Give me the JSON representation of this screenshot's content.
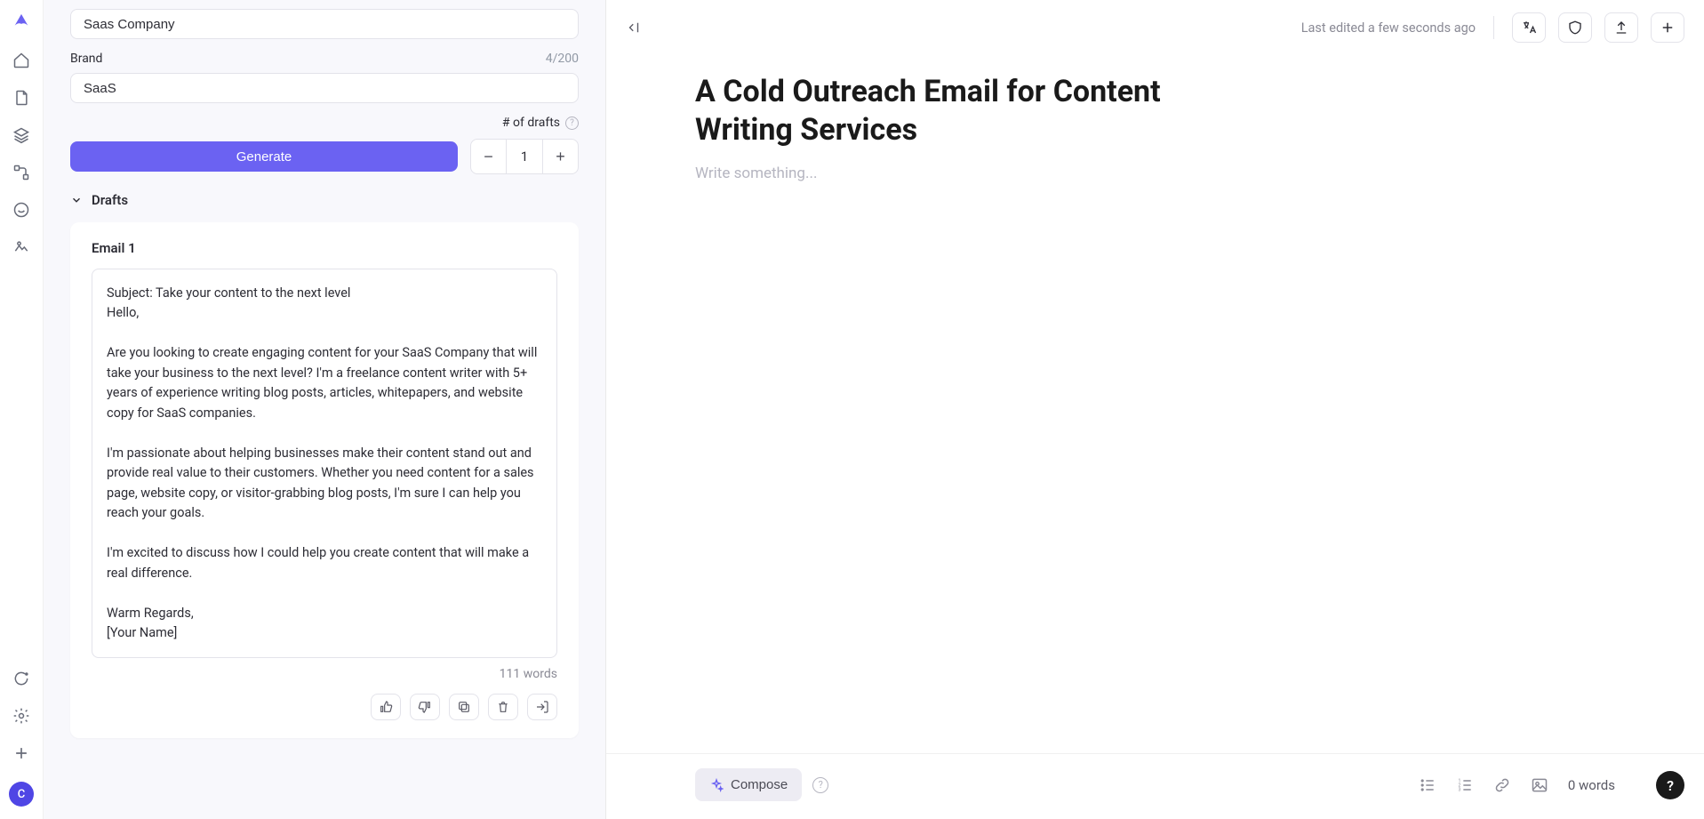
{
  "sidebar": {
    "avatar_initial": "C"
  },
  "left_panel": {
    "company_input": {
      "value": "Saas Company"
    },
    "brand": {
      "label": "Brand",
      "counter": "4/200",
      "value": "SaaS"
    },
    "drafts_count": {
      "label": "# of drafts",
      "value": "1"
    },
    "generate_label": "Generate",
    "drafts_header": "Drafts",
    "draft": {
      "title": "Email 1",
      "body": "Subject: Take your content to the next level\nHello,\n\nAre you looking to create engaging content for your SaaS Company that will take your business to the next level? I'm a freelance content writer with 5+ years of experience writing blog posts, articles, whitepapers, and website copy for SaaS companies.\n\nI'm passionate about helping businesses make their content stand out and provide real value to their customers. Whether you need content for a sales page, website copy, or visitor-grabbing blog posts, I'm sure I can help you reach your goals.\n\nI'm excited to discuss how I could help you create content that will make a real difference.\n\nWarm Regards,\n[Your Name]",
      "word_count": "111 words"
    }
  },
  "editor": {
    "last_edited": "Last edited a few seconds ago",
    "title": "A Cold Outreach Email for Content Writing Services",
    "placeholder": "Write something...",
    "compose_label": "Compose",
    "footer_words": "0 words"
  }
}
